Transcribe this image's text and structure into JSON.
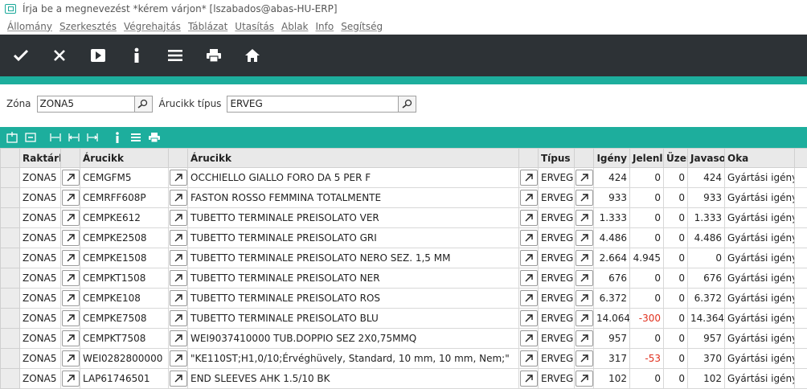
{
  "window": {
    "title": "Írja be a megnevezést  *kérem várjon*  [lszabados@abas-HU-ERP]"
  },
  "menu": [
    "Állomány",
    "Szerkesztés",
    "Végrehajtás",
    "Táblázat",
    "Utasítás",
    "Ablak",
    "Info",
    "Segítség"
  ],
  "toolbar": {
    "icons": [
      "check-icon",
      "close-icon",
      "play-icon",
      "info-icon",
      "menu-icon",
      "print-icon",
      "home-icon"
    ]
  },
  "filters": {
    "zona_label": "Zóna",
    "zona_value": "ZONA5",
    "arucikk_tipus_label": "Árucikk típus",
    "arucikk_tipus_value": "ERVEG"
  },
  "table": {
    "columns": [
      "Raktárh",
      "Árucikk",
      "Árucikk",
      "Típus",
      "Igény",
      "Jelenl",
      "Üzer",
      "Javaso",
      "Oka"
    ],
    "rows": [
      [
        "ZONA5",
        "CEMGFM5",
        "OCCHIELLO GIALLO FORO DA 5 PER F",
        "ERVEG",
        "424",
        "0",
        "0",
        "424",
        "Gyártási igény"
      ],
      [
        "ZONA5",
        "CEMRFF608P",
        "FASTON ROSSO FEMMINA TOTALMENTE",
        "ERVEG",
        "933",
        "0",
        "0",
        "933",
        "Gyártási igény"
      ],
      [
        "ZONA5",
        "CEMPKE612",
        "TUBETTO TERMINALE PREISOLATO VER",
        "ERVEG",
        "1.333",
        "0",
        "0",
        "1.333",
        "Gyártási igény"
      ],
      [
        "ZONA5",
        "CEMPKE2508",
        "TUBETTO TERMINALE PREISOLATO GRI",
        "ERVEG",
        "4.486",
        "0",
        "0",
        "4.486",
        "Gyártási igény"
      ],
      [
        "ZONA5",
        "CEMPKE1508",
        "TUBETTO TERMINALE PREISOLATO NERO SEZ. 1,5 MM",
        "ERVEG",
        "2.664",
        "4.945",
        "0",
        "0",
        "Gyártási igény"
      ],
      [
        "ZONA5",
        "CEMPKT1508",
        "TUBETTO TERMINALE PREISOLATO NER",
        "ERVEG",
        "676",
        "0",
        "0",
        "676",
        "Gyártási igény"
      ],
      [
        "ZONA5",
        "CEMPKE108",
        "TUBETTO TERMINALE PREISOLATO ROS",
        "ERVEG",
        "6.372",
        "0",
        "0",
        "6.372",
        "Gyártási igény"
      ],
      [
        "ZONA5",
        "CEMPKE7508",
        "TUBETTO TERMINALE PREISOLATO BLU",
        "ERVEG",
        "14.064",
        "-300",
        "0",
        "14.364",
        "Gyártási igény"
      ],
      [
        "ZONA5",
        "CEMPKT7508",
        "WEI9037410000 TUB.DOPPIO SEZ 2X0,75MMQ",
        "ERVEG",
        "957",
        "0",
        "0",
        "957",
        "Gyártási igény"
      ],
      [
        "ZONA5",
        "WEI0282800000",
        "\"KE110ST;H1,0/10;Érvéghüvely, Standard, 10 mm, 10 mm, Nem;\"",
        "ERVEG",
        "317",
        "-53",
        "0",
        "370",
        "Gyártási igény"
      ],
      [
        "ZONA5",
        "LAP61746501",
        "END SLEEVES AHK 1.5/10 BK",
        "ERVEG",
        "102",
        "0",
        "0",
        "102",
        "Gyártási igény"
      ]
    ]
  },
  "colors": {
    "accent": "#1dae9d",
    "toolbar_bg": "#2d3236",
    "negative": "#e0301e"
  }
}
